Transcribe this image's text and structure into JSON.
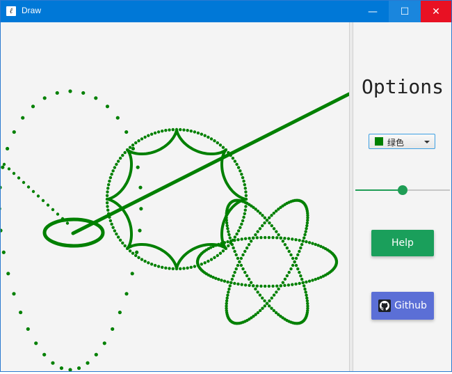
{
  "window": {
    "title": "Draw",
    "minimize_glyph": "—",
    "maximize_glyph": "☐",
    "close_glyph": "✕"
  },
  "panel": {
    "title": "Options",
    "color_select": {
      "selected": "绿色",
      "swatch_color": "#008000"
    },
    "slider": {
      "value": 0.5
    },
    "help_label": "Help",
    "github_label": "Github"
  },
  "drawing": {
    "stroke_color": "#008000"
  }
}
